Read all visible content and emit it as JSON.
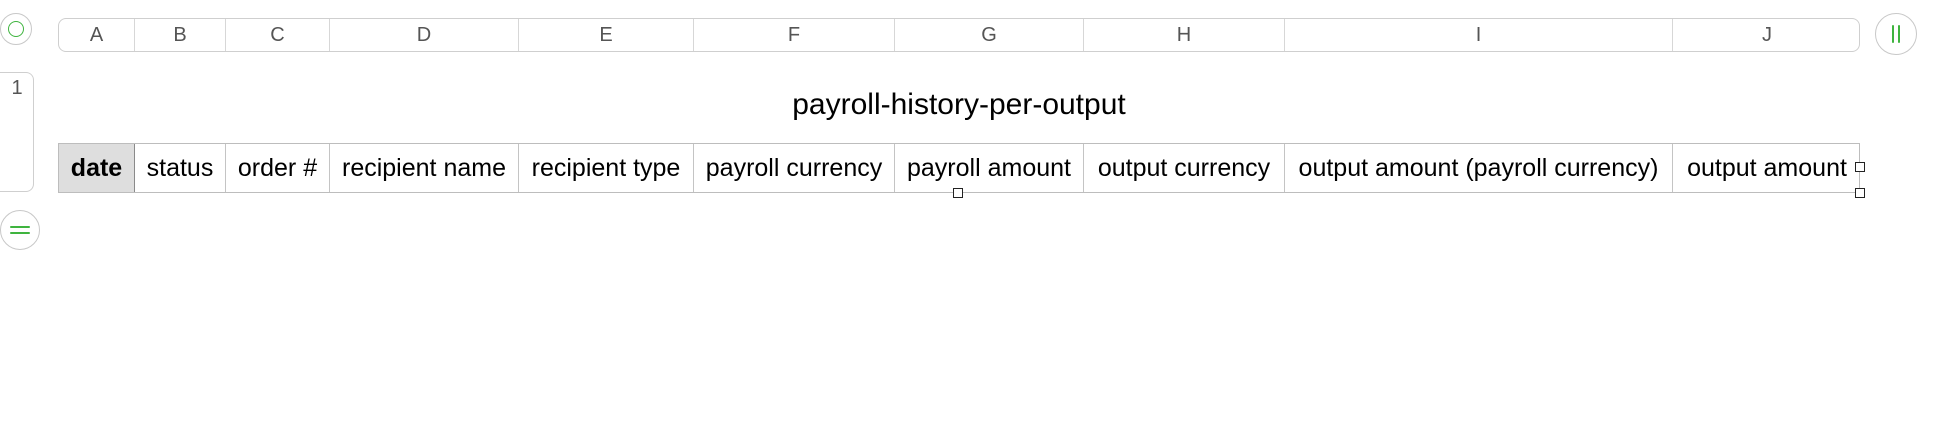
{
  "sheet": {
    "columns": [
      "A",
      "B",
      "C",
      "D",
      "E",
      "F",
      "G",
      "H",
      "I",
      "J"
    ],
    "row_numbers": [
      "1"
    ],
    "table_title": "payroll-history-per-output",
    "header_row": [
      "date",
      "status",
      "order #",
      "recipient name",
      "recipient type",
      "payroll currency",
      "payroll amount",
      "output currency",
      "output amount (payroll currency)",
      "output amount"
    ],
    "selected_cell": "A1"
  },
  "colors": {
    "accent": "#3fb43f",
    "selected_cell_bg": "#dedede",
    "border": "#cfcfcf"
  },
  "icons": {
    "select_all": "circle-icon",
    "column_handle": "pause-icon",
    "row_handle": "equals-icon"
  }
}
